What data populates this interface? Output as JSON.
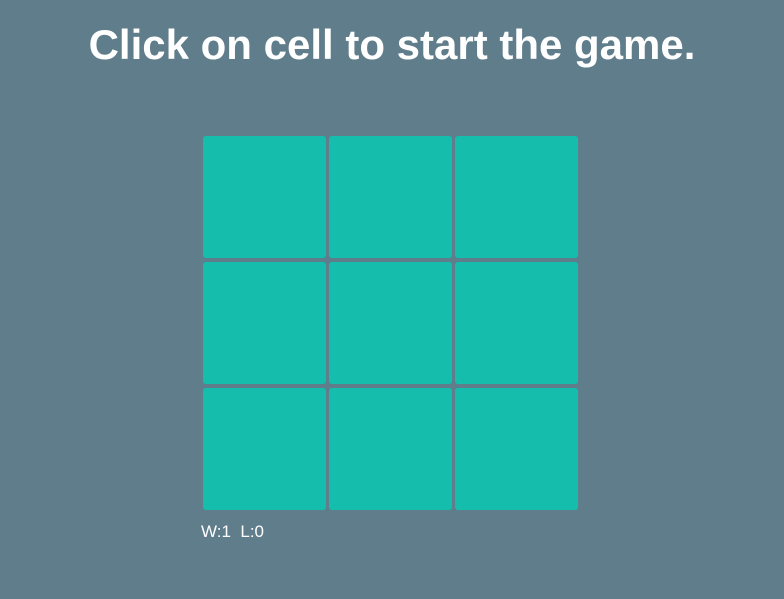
{
  "status": {
    "message": "Click on cell to start the game."
  },
  "board": {
    "cells": [
      "",
      "",
      "",
      "",
      "",
      "",
      "",
      "",
      ""
    ]
  },
  "score": {
    "wins_label": "W:1",
    "losses_label": "L:0"
  },
  "colors": {
    "background": "#607d8b",
    "cell": "#14bdac",
    "text": "#ffffff"
  }
}
